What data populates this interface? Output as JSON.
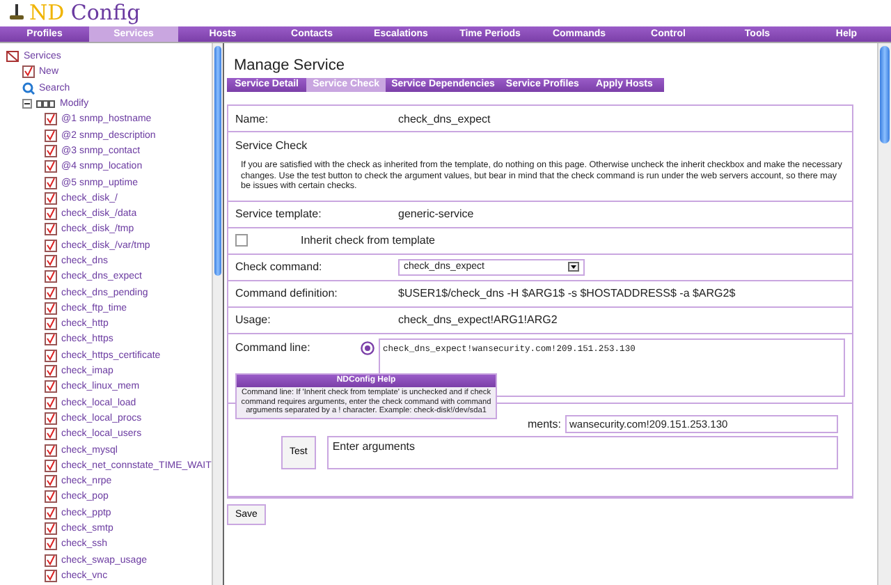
{
  "app": {
    "title_part1": "ND",
    "title_part2": "Config"
  },
  "nav": [
    {
      "label": "Profiles",
      "selected": false
    },
    {
      "label": "Services",
      "selected": true
    },
    {
      "label": "Hosts",
      "selected": false
    },
    {
      "label": "Contacts",
      "selected": false
    },
    {
      "label": "Escalations",
      "selected": false
    },
    {
      "label": "Time Periods",
      "selected": false
    },
    {
      "label": "Commands",
      "selected": false
    },
    {
      "label": "Control",
      "selected": false
    },
    {
      "label": "Tools",
      "selected": false
    },
    {
      "label": "Help",
      "selected": false
    }
  ],
  "tree": {
    "label": "Services",
    "children": [
      {
        "label": "New",
        "kind": "new"
      },
      {
        "label": "Search",
        "kind": "search"
      },
      {
        "label": "Modify",
        "kind": "modify",
        "expanded": true,
        "children": [
          {
            "label": "@1 snmp_hostname"
          },
          {
            "label": "@2 snmp_description"
          },
          {
            "label": "@3 snmp_contact"
          },
          {
            "label": "@4 snmp_location"
          },
          {
            "label": "@5 snmp_uptime"
          },
          {
            "label": "check_disk_/"
          },
          {
            "label": "check_disk_/data"
          },
          {
            "label": "check_disk_/tmp"
          },
          {
            "label": "check_disk_/var/tmp"
          },
          {
            "label": "check_dns"
          },
          {
            "label": "check_dns_expect"
          },
          {
            "label": "check_dns_pending"
          },
          {
            "label": "check_ftp_time"
          },
          {
            "label": "check_http"
          },
          {
            "label": "check_https"
          },
          {
            "label": "check_https_certificate"
          },
          {
            "label": "check_imap"
          },
          {
            "label": "check_linux_mem"
          },
          {
            "label": "check_local_load"
          },
          {
            "label": "check_local_procs"
          },
          {
            "label": "check_local_users"
          },
          {
            "label": "check_mysql"
          },
          {
            "label": "check_net_connstate_TIME_WAIT"
          },
          {
            "label": "check_nrpe"
          },
          {
            "label": "check_pop"
          },
          {
            "label": "check_pptp"
          },
          {
            "label": "check_smtp"
          },
          {
            "label": "check_ssh"
          },
          {
            "label": "check_swap_usage"
          },
          {
            "label": "check_vnc"
          }
        ]
      }
    ]
  },
  "page_title": "Manage Service",
  "tabs": [
    {
      "label": "Service Detail",
      "selected": false
    },
    {
      "label": "Service Check",
      "selected": true
    },
    {
      "label": "Service Dependencies",
      "selected": false
    },
    {
      "label": "Service Profiles",
      "selected": false
    },
    {
      "label": "Apply Hosts",
      "selected": false
    }
  ],
  "name": {
    "label": "Name:",
    "value": "check_dns_expect"
  },
  "section": {
    "title": "Service Check",
    "text": "If you are satisfied with the check as inherited from the template, do nothing on this page. Otherwise uncheck the inherit checkbox and make the necessary changes. Use the test button to check the argument values, but bear in mind that the check command is run under the web servers account, so there may be issues with certain checks."
  },
  "template": {
    "label": "Service template:",
    "value": "generic-service"
  },
  "inherit": {
    "label": "Inherit check from template",
    "checked": false
  },
  "check_command": {
    "label": "Check command:",
    "value": "check_dns_expect"
  },
  "definition": {
    "label": "Command definition:",
    "value": "$USER1$/check_dns -H $ARG1$ -s $HOSTADDRESS$ -a $ARG2$"
  },
  "usage": {
    "label": "Usage:",
    "value": "check_dns_expect!ARG1!ARG2"
  },
  "command_line": {
    "label": "Command line:",
    "value": "check_dns_expect!wansecurity.com!209.151.253.130"
  },
  "help": {
    "title": "NDConfig Help",
    "text": "Command line: If 'Inherit check from template' is unchecked and if check command requires arguments, enter the check command with command arguments separated by a ! character. Example: check-disk!/dev/sda1"
  },
  "arguments": {
    "label": "ments:",
    "value": "wansecurity.com!209.151.253.130",
    "button": "Test",
    "result": "Enter arguments"
  },
  "save": "Save"
}
